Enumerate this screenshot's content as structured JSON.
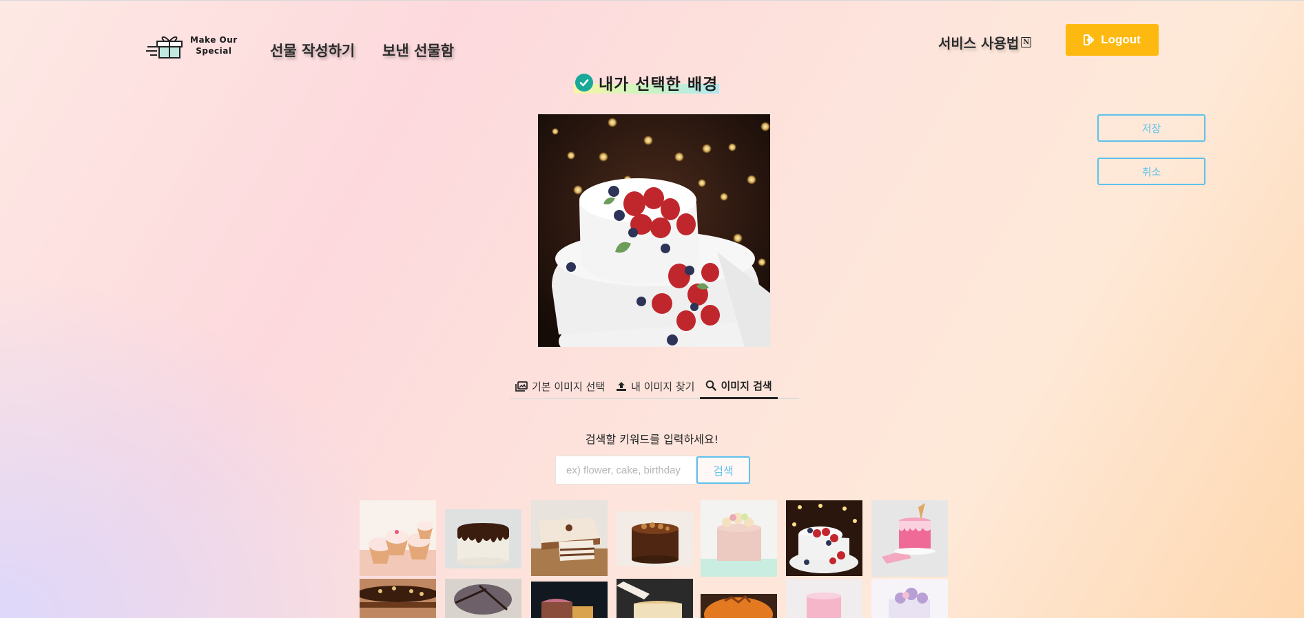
{
  "header": {
    "logo_line1": "Make Our",
    "logo_line2": "Special",
    "nav": [
      "선물 작성하기",
      "보낸 선물함"
    ],
    "howto_label": "서비스 사용법",
    "notion_icon": "N",
    "logout_label": "Logout"
  },
  "title": "내가 선택한 배경",
  "actions": {
    "save": "저장",
    "cancel": "취소"
  },
  "tabs": [
    {
      "label": "기본 이미지 선택",
      "icon": "images-icon"
    },
    {
      "label": "내 이미지 찾기",
      "icon": "upload-icon"
    },
    {
      "label": "이미지 검색",
      "icon": "search-icon",
      "active": true
    }
  ],
  "search": {
    "prompt": "검색할 키워드를 입력하세요!",
    "placeholder": "ex) flower, cake, birthday",
    "button": "검색"
  },
  "colors": {
    "accent": "#5ec1ee",
    "logout": "#fdb90f",
    "check": "#1aa899"
  }
}
